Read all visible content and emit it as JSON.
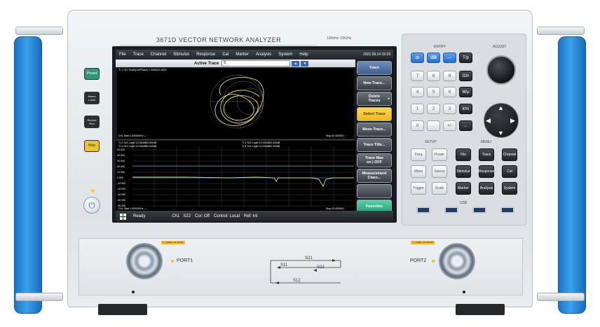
{
  "instrument": {
    "model_title": "3671D VECTOR NETWORK ANALYZER",
    "freq_range": "100kHz~20GHz"
  },
  "left_panel": {
    "preset_label": "Preset",
    "macro_label": "Macro\nLocal",
    "record_label": "Record\nRun",
    "help_label": "Help"
  },
  "menubar": {
    "items": [
      "File",
      "Trace",
      "Channel",
      "Stimulus",
      "Response",
      "Cal",
      "Marker",
      "Analysis",
      "System",
      "Help"
    ],
    "datetime": "2021.09.14 15:29"
  },
  "active_trace": {
    "label": "Active Trace",
    "value": "5"
  },
  "plot": {
    "trace1_header": "Tr 1  S11 Smith(Lin/Phase) 1.0000U/1.0000",
    "top_footer_left": "Ch1  Start:1.000000Hz  —",
    "top_footer_right": "Stop:20.000000",
    "bottom_hdr_1": "Tr 2  S21 LogM 10.000dB/0.000dB",
    "bottom_hdr_2": "Tr 3  S12 LogM 10.000dB/0.000dB",
    "bottom_hdr_3": "Tr 4  S22 LogM 10.000dB/0.000dB",
    "bottom_hdr_4": "Tr 5  S22 LogM 10.000dB/0.000dB",
    "y_ticks": [
      "50.000",
      "40.000",
      "30.000",
      "20.000",
      "10.000",
      "0.000",
      "-10.000",
      "-20.000",
      "-30.000",
      "-40.000",
      "-50.000"
    ],
    "bottom_footer_left": "Ch1  Start:1.000000Hz  —",
    "bottom_footer_right": "Stop:20.000000"
  },
  "softkeys": [
    "Trace",
    "New Trace...",
    "Delete\nTraces",
    "Select Trace",
    "Move Trace...",
    "Trace Title...",
    "Trace Max\non | OFF",
    "Measurement\nClass...",
    "",
    "Favorites"
  ],
  "status": {
    "ready": "Ready",
    "channel": "Ch1",
    "param": "S22",
    "cor": "Cor: Off",
    "control": "Control: Local",
    "ref": "Ref: Int"
  },
  "keypad": {
    "entry_label": "ENTRY",
    "adjust_label": "ADJUST",
    "setup_label": "SETUP",
    "menu_label": "MENU",
    "usb_label": "USB",
    "unit_keys": [
      "T/p",
      "G/n",
      "M/μ",
      "k/m"
    ],
    "num_rows": [
      [
        "7",
        "8",
        "9"
      ],
      [
        "4",
        "5",
        "6"
      ],
      [
        "1",
        "2",
        "3"
      ],
      [
        "0",
        ".",
        "+/-"
      ]
    ],
    "setup_keys": [
      [
        "Freq",
        "Power"
      ],
      [
        "Meas",
        "Sweep"
      ],
      [
        "Trigger",
        "Scale"
      ]
    ],
    "menu_keys": [
      [
        "File",
        "Trace",
        "Channel"
      ],
      [
        "Stimulus",
        "Response",
        "Cal"
      ],
      [
        "Marker",
        "Analysis",
        "System"
      ]
    ]
  },
  "ports": {
    "port1_label": "PORT1",
    "port2_label": "PORT2",
    "diagram_s21": "S21",
    "diagram_s11": "S11",
    "diagram_s22": "S22",
    "diagram_s12": "S12",
    "warning_text": "⚠ +16dBm RF 35VDC"
  }
}
